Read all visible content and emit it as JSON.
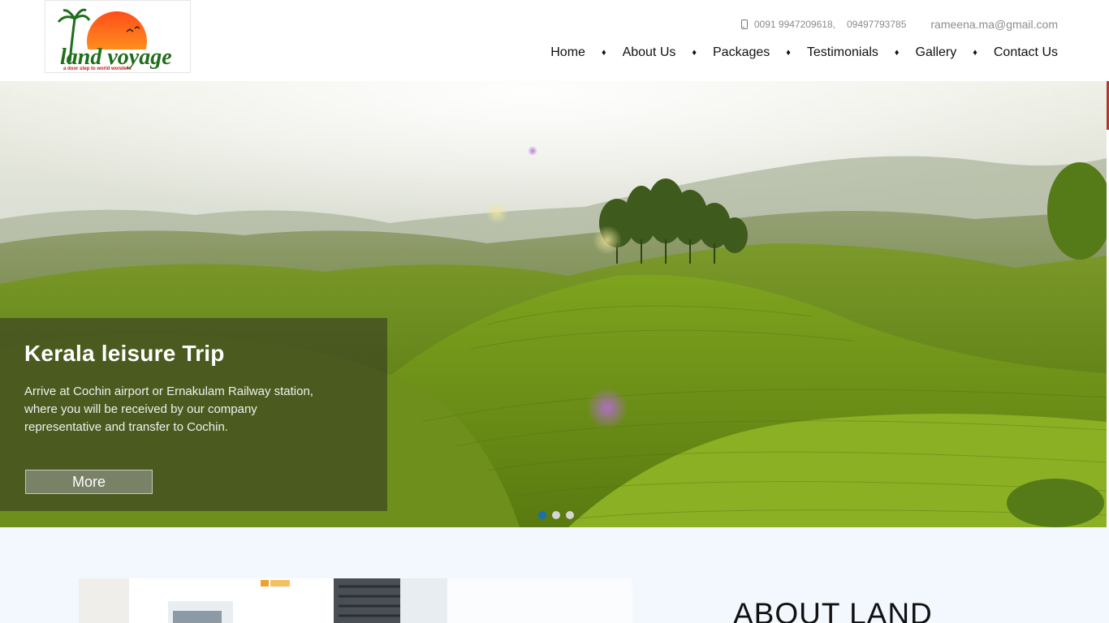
{
  "brand": {
    "logo_alt": "land voyage",
    "logo_text": "land voyage",
    "tagline": "a door step to world wonders",
    "colors": {
      "sun": "#ff7a1a",
      "green": "#1f6e1a",
      "tagline": "#d01818"
    }
  },
  "contact": {
    "phone_icon": "mobile-phone-icon",
    "phone1": "0091 9947209618,",
    "phone2": "09497793785",
    "email": "rameena.ma@gmail.com"
  },
  "nav": {
    "separator": "♦",
    "items": [
      {
        "label": "Home"
      },
      {
        "label": "About Us"
      },
      {
        "label": "Packages"
      },
      {
        "label": "Testimonials"
      },
      {
        "label": "Gallery"
      },
      {
        "label": "Contact Us"
      }
    ]
  },
  "hero": {
    "slide_title": "Kerala leisure Trip",
    "slide_text": "Arrive at Cochin airport or Ernakulam Railway station, where you will be received by our company representative and transfer to Cochin.",
    "more_label": "More",
    "active_slide": 1,
    "slide_count": 3
  },
  "about": {
    "title": "ABOUT LAND"
  },
  "theme": {
    "accent": "#b03a2e",
    "dot_active": "#1a6fb3",
    "about_bg": "#f2f8fd"
  }
}
